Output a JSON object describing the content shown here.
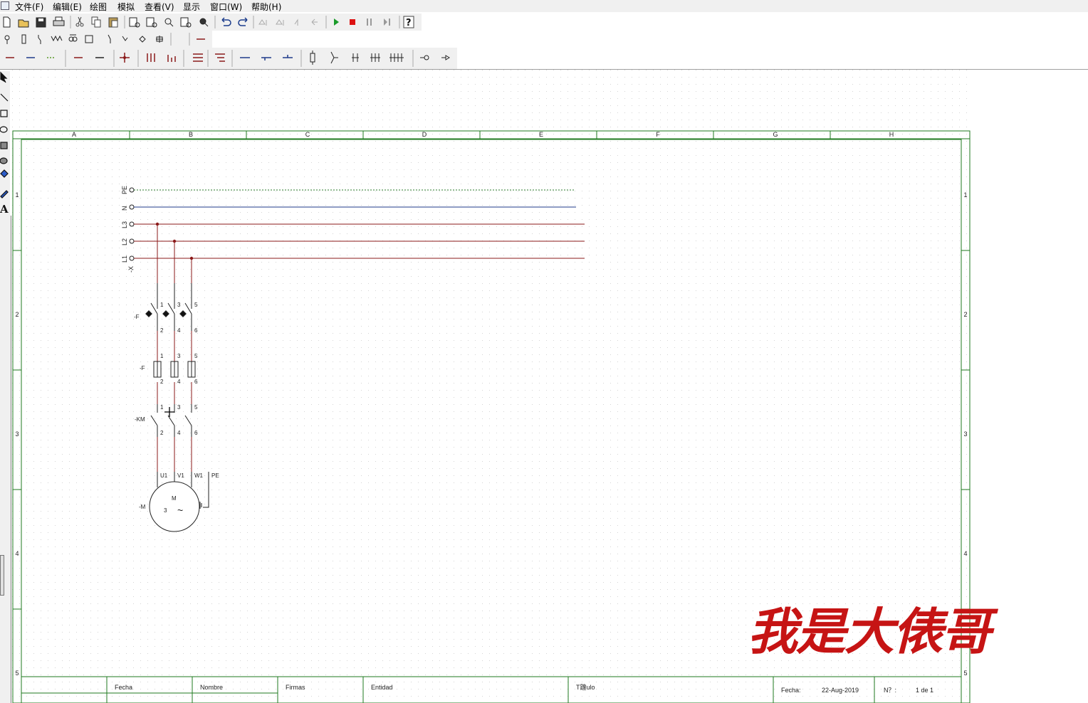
{
  "menu": {
    "items": [
      "文件(F)",
      "编辑(E)",
      "绘图",
      "模拟",
      "查看(V)",
      "显示",
      "窗口(W)",
      "帮助(H)"
    ]
  },
  "toolbar_icons": {
    "row1": [
      "new-icon",
      "open-icon",
      "save-icon",
      "print-icon",
      "cut-icon",
      "copy-icon",
      "paste-icon",
      "print-preview-icon",
      "zoom-icon",
      "undo-icon",
      "redo-icon",
      "play-icon",
      "stop-icon",
      "pause-icon",
      "step-icon",
      "help-icon"
    ],
    "row2": [
      "lamp-icon",
      "fuse-icon",
      "contact-icon",
      "switch-icon",
      "coil-icon",
      "node-icon",
      "cross-icon",
      "wire-icon"
    ],
    "row3": [
      "wire-styles-icon",
      "terminal-icon",
      "busbar-icon",
      "connector-icon"
    ],
    "left": [
      "pointer-icon",
      "line-icon",
      "rectangle-icon",
      "ellipse-icon",
      "filled-rectangle-icon",
      "filled-ellipse-icon",
      "fill-icon",
      "pen-icon",
      "text-tool-icon"
    ]
  },
  "sheet": {
    "columns": [
      "A",
      "B",
      "C",
      "D",
      "E",
      "F",
      "G",
      "H"
    ],
    "rows": [
      "1",
      "2",
      "3",
      "4",
      "5"
    ]
  },
  "schematic": {
    "bus_labels": [
      "PE",
      "N",
      "L3",
      "L2",
      "L1"
    ],
    "terminal_tag": "-X",
    "breaker_tag": "-F",
    "breaker_top": [
      "1",
      "3",
      "5"
    ],
    "breaker_bottom": [
      "2",
      "4",
      "6"
    ],
    "fuse_tag": "-F",
    "fuse_top": [
      "1",
      "3",
      "5"
    ],
    "fuse_bottom": [
      "2",
      "4",
      "6"
    ],
    "contactor_tag": "-KM",
    "contactor_top": [
      "1",
      "3",
      "5"
    ],
    "contactor_bottom": [
      "2",
      "4",
      "6"
    ],
    "motor_tag": "-M",
    "motor_terminals": [
      "U1",
      "V1",
      "W1",
      "PE"
    ],
    "motor_letter": "M",
    "motor_phase": "3",
    "motor_ac": "~"
  },
  "title_block": {
    "fecha_col": "Fecha",
    "nombre_col": "Nombre",
    "firmas": "Firmas",
    "entidad": "Entidad",
    "titulo": "T韙ulo",
    "fecha_label": "Fecha:",
    "fecha_value": "22-Aug-2019",
    "num_label": "N？:",
    "num_value": "1 de 1"
  },
  "watermark": "我是大俵哥",
  "colors": {
    "frame": "#1f7a1f",
    "phase": "#8b1a1a",
    "neutral": "#1f3a8a",
    "pe": "#2a7a2a",
    "watermark": "#c61414"
  }
}
